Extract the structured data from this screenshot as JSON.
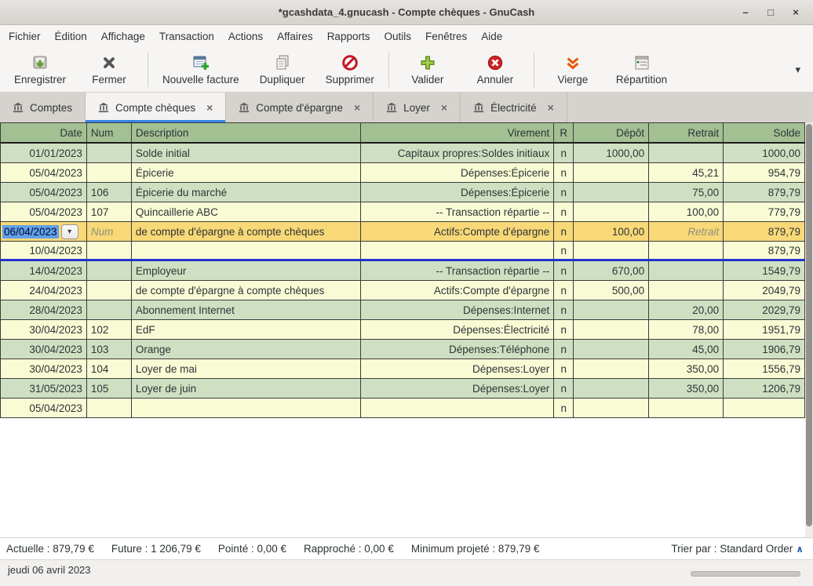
{
  "colors": {
    "accent": "#3584e4",
    "header_green": "#a3c093",
    "row_green": "#cfe0c2",
    "row_yellow": "#f9fbd5",
    "row_selected": "#f8d877",
    "divider_blue": "#2433cf",
    "selection_blue": "#62a0ea"
  },
  "window": {
    "title": "*gcashdata_4.gnucash - Compte chèques - GnuCash",
    "controls": {
      "minimize": "–",
      "maximize": "□",
      "close": "×"
    }
  },
  "menubar": {
    "items": [
      "Fichier",
      "Édition",
      "Affichage",
      "Transaction",
      "Actions",
      "Affaires",
      "Rapports",
      "Outils",
      "Fenêtres",
      "Aide"
    ]
  },
  "toolbar": {
    "overflow_glyph": "▾",
    "buttons": [
      {
        "label": "Enregistrer",
        "icon": "save-icon",
        "separator_after": false
      },
      {
        "label": "Fermer",
        "icon": "close-x-icon",
        "separator_after": true
      },
      {
        "label": "Nouvelle facture",
        "icon": "new-invoice-icon",
        "separator_after": false
      },
      {
        "label": "Dupliquer",
        "icon": "duplicate-icon",
        "separator_after": false
      },
      {
        "label": "Supprimer",
        "icon": "delete-icon",
        "separator_after": true
      },
      {
        "label": "Valider",
        "icon": "enter-icon",
        "separator_after": false
      },
      {
        "label": "Annuler",
        "icon": "cancel-icon",
        "separator_after": true
      },
      {
        "label": "Vierge",
        "icon": "blank-icon",
        "separator_after": false
      },
      {
        "label": "Répartition",
        "icon": "split-icon",
        "separator_after": false
      }
    ]
  },
  "tabs": [
    {
      "label": "Comptes",
      "icon": "bank-icon",
      "closable": false,
      "active": false
    },
    {
      "label": "Compte chèques",
      "icon": "bank-icon",
      "closable": true,
      "active": true
    },
    {
      "label": "Compte d'épargne",
      "icon": "bank-icon",
      "closable": true,
      "active": false
    },
    {
      "label": "Loyer",
      "icon": "bank-icon",
      "closable": true,
      "active": false
    },
    {
      "label": "Électricité",
      "icon": "bank-icon",
      "closable": true,
      "active": false
    }
  ],
  "icons": {
    "tab_close_glyph": "×",
    "combo_chevron": "▾"
  },
  "register": {
    "columns": [
      "Date",
      "Num",
      "Description",
      "Virement",
      "R",
      "Dépôt",
      "Retrait",
      "Solde"
    ],
    "rows": [
      {
        "variant": "green",
        "date": "01/01/2023",
        "num": "",
        "description": "Solde initial",
        "virement": "Capitaux propres:Soldes initiaux",
        "r": "n",
        "depot": "1000,00",
        "retrait": "",
        "solde": "1000,00"
      },
      {
        "variant": "yellow",
        "date": "05/04/2023",
        "num": "",
        "description": "Épicerie",
        "virement": "Dépenses:Épicerie",
        "r": "n",
        "depot": "",
        "retrait": "45,21",
        "solde": "954,79"
      },
      {
        "variant": "green",
        "date": "05/04/2023",
        "num": "106",
        "description": "Épicerie du marché",
        "virement": "Dépenses:Épicerie",
        "r": "n",
        "depot": "",
        "retrait": "75,00",
        "solde": "879,79"
      },
      {
        "variant": "yellow",
        "date": "05/04/2023",
        "num": "107",
        "description": "Quincaillerie ABC",
        "virement": "-- Transaction répartie --",
        "r": "n",
        "depot": "",
        "retrait": "100,00",
        "solde": "779,79"
      },
      {
        "variant": "selected",
        "selected": true,
        "date": "06/04/2023",
        "num": "",
        "num_placeholder": "Num",
        "description": "de compte d'épargne à compte chèques",
        "virement": "Actifs:Compte d'épargne",
        "r": "n",
        "depot": "100,00",
        "retrait": "",
        "retrait_placeholder": "Retrait",
        "solde": "879,79"
      },
      {
        "variant": "yellow",
        "blue_divider": true,
        "date": "10/04/2023",
        "num": "",
        "description": "",
        "virement": "",
        "r": "n",
        "depot": "",
        "retrait": "",
        "solde": "879,79"
      },
      {
        "variant": "green",
        "date": "14/04/2023",
        "num": "",
        "description": "Employeur",
        "virement": "-- Transaction répartie --",
        "r": "n",
        "depot": "670,00",
        "retrait": "",
        "solde": "1549,79"
      },
      {
        "variant": "yellow",
        "date": "24/04/2023",
        "num": "",
        "description": "de compte d'épargne à compte chèques",
        "virement": "Actifs:Compte d'épargne",
        "r": "n",
        "depot": "500,00",
        "retrait": "",
        "solde": "2049,79"
      },
      {
        "variant": "green",
        "date": "28/04/2023",
        "num": "",
        "description": "Abonnement Internet",
        "virement": "Dépenses:Internet",
        "r": "n",
        "depot": "",
        "retrait": "20,00",
        "solde": "2029,79"
      },
      {
        "variant": "yellow",
        "date": "30/04/2023",
        "num": "102",
        "description": "EdF",
        "virement": "Dépenses:Électricité",
        "r": "n",
        "depot": "",
        "retrait": "78,00",
        "solde": "1951,79"
      },
      {
        "variant": "green",
        "date": "30/04/2023",
        "num": "103",
        "description": "Orange",
        "virement": "Dépenses:Téléphone",
        "r": "n",
        "depot": "",
        "retrait": "45,00",
        "solde": "1906,79"
      },
      {
        "variant": "yellow",
        "date": "30/04/2023",
        "num": "104",
        "description": "Loyer de mai",
        "virement": "Dépenses:Loyer",
        "r": "n",
        "depot": "",
        "retrait": "350,00",
        "solde": "1556,79"
      },
      {
        "variant": "green",
        "date": "31/05/2023",
        "num": "105",
        "description": "Loyer de juin",
        "virement": "Dépenses:Loyer",
        "r": "n",
        "depot": "",
        "retrait": "350,00",
        "solde": "1206,79"
      },
      {
        "variant": "yellow",
        "date": "05/04/2023",
        "num": "",
        "description": "",
        "virement": "",
        "r": "n",
        "depot": "",
        "retrait": "",
        "solde": ""
      }
    ]
  },
  "summary": {
    "items": [
      {
        "label": "Actuelle",
        "value": "879,79 €"
      },
      {
        "label": "Future",
        "value": "1 206,79 €"
      },
      {
        "label": "Pointé",
        "value": "0,00 €"
      },
      {
        "label": "Rapproché",
        "value": "0,00 €"
      },
      {
        "label": "Minimum projeté",
        "value": "879,79 €"
      }
    ],
    "sort_label": "Trier par : ",
    "sort_value": "Standard Order",
    "sort_caret": "∧"
  },
  "statusbar": {
    "date_text": "jeudi 06 avril 2023"
  }
}
